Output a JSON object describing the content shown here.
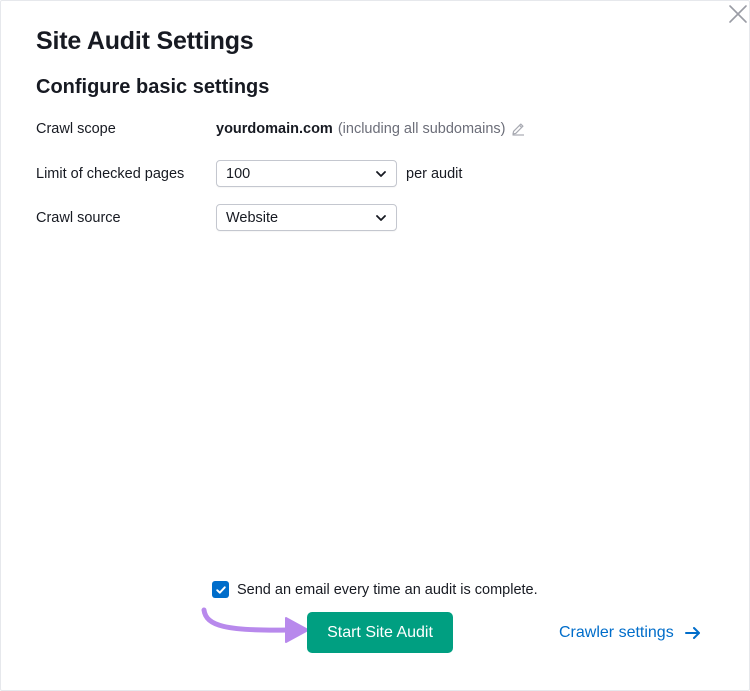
{
  "dialog": {
    "title": "Site Audit Settings",
    "subtitle": "Configure basic settings"
  },
  "crawl_scope": {
    "label": "Crawl scope",
    "domain": "yourdomain.com",
    "note": "(including all subdomains)",
    "edit_icon": "pencil-icon"
  },
  "limit": {
    "label": "Limit of checked pages",
    "value": "100",
    "suffix": "per audit"
  },
  "source": {
    "label": "Crawl source",
    "value": "Website"
  },
  "email": {
    "checked": true,
    "label": "Send an email every time an audit is complete."
  },
  "actions": {
    "start_label": "Start Site Audit",
    "crawler_label": "Crawler settings"
  },
  "colors": {
    "primary_green": "#009f81",
    "link_blue": "#006dca",
    "annotation_purple": "#b889ec"
  }
}
